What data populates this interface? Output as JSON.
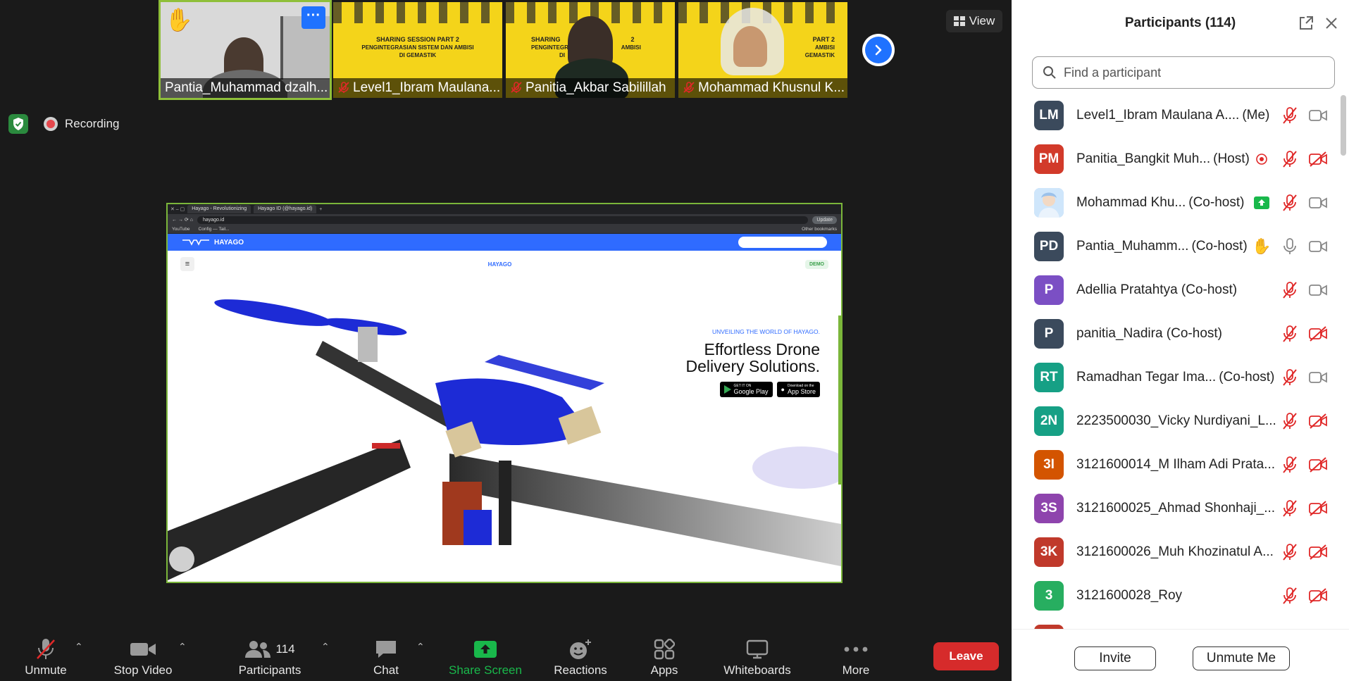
{
  "thumbnails": [
    {
      "name": "Pantia_Muhammad dzalh...",
      "muted": false,
      "raised_hand": true
    },
    {
      "name": "Level1_Ibram Maulana...",
      "muted": true,
      "poster_title": "SHARING SESSION PART 2",
      "poster_sub": "PENGINTEGRASIAN SISTEM DAN AMBISI",
      "poster_sub2": "DI GEMASTIK"
    },
    {
      "name": "Panitia_Akbar Sabilillah",
      "muted": true,
      "poster_title": "SHARING",
      "poster_title_right": "2",
      "poster_sub": "PENGINTEGRASIAN",
      "poster_sub_right": "AMBISI",
      "poster_sub2": "DI"
    },
    {
      "name": "Mohammad Khusnul K...",
      "muted": true,
      "poster_title": "PART 2",
      "poster_sub": "AMBISI",
      "poster_sub2": "GEMASTIK"
    }
  ],
  "view_label": "View",
  "recording_label": "Recording",
  "share": {
    "tab1": "Hayago - Revolutionizing",
    "tab2": "Hayago ID (@hayago.id)",
    "url": "hayago.id",
    "update_label": "Update",
    "bookmark1": "YouTube",
    "bookmark2": "Config — Tail...",
    "bookmark_other": "Other bookmarks",
    "brand": "HAYAGO",
    "nav_logo": "HAYAGO",
    "demo_label": "DEMO",
    "tagline": "UNVEILING THE WORLD OF HAYAGO.",
    "headline_1": "Effortless Drone",
    "headline_2": "Delivery Solutions.",
    "google_small": "GET IT ON",
    "google_big": "Google Play",
    "apple_small": "Download on the",
    "apple_big": "App Store"
  },
  "toolbar": {
    "unmute": "Unmute",
    "stop_video": "Stop Video",
    "participants": "Participants",
    "participants_count": "114",
    "chat": "Chat",
    "share_screen": "Share Screen",
    "reactions": "Reactions",
    "apps": "Apps",
    "whiteboards": "Whiteboards",
    "more": "More",
    "leave": "Leave"
  },
  "panel": {
    "title": "Participants (114)",
    "search_placeholder": "Find a participant",
    "invite": "Invite",
    "unmute_me": "Unmute Me",
    "participants": [
      {
        "initials": "LM",
        "color": "#3b4a5c",
        "name": "Level1_Ibram Maulana A....",
        "role": "(Me)",
        "mic": "muted",
        "video": "on"
      },
      {
        "initials": "PM",
        "color": "#d23a2a",
        "name": "Panitia_Bangkit Muh...",
        "role": "(Host)",
        "mic": "muted",
        "video": "off",
        "extra": "recording"
      },
      {
        "initials": "",
        "color": "#9ec9f0",
        "name": "Mohammad Khu...",
        "role": "(Co-host)",
        "mic": "muted",
        "video": "on",
        "extra": "sharing",
        "photo": true
      },
      {
        "initials": "PD",
        "color": "#3b4a5c",
        "name": "Pantia_Muhamm...",
        "role": "(Co-host)",
        "mic": "on",
        "video": "on",
        "extra": "hand"
      },
      {
        "initials": "P",
        "color": "#7b4fc4",
        "name": "Adellia Pratahtya (Co-host)",
        "role": "",
        "mic": "muted",
        "video": "on"
      },
      {
        "initials": "P",
        "color": "#3b4a5c",
        "name": "panitia_Nadira (Co-host)",
        "role": "",
        "mic": "muted",
        "video": "off"
      },
      {
        "initials": "RT",
        "color": "#16a085",
        "name": "Ramadhan Tegar Ima...",
        "role": "(Co-host)",
        "mic": "muted",
        "video": "on"
      },
      {
        "initials": "2N",
        "color": "#16a085",
        "name": "2223500030_Vicky Nurdiyani_L...",
        "role": "",
        "mic": "muted",
        "video": "off"
      },
      {
        "initials": "3I",
        "color": "#d35400",
        "name": "3121600014_M Ilham Adi Prata...",
        "role": "",
        "mic": "muted",
        "video": "off"
      },
      {
        "initials": "3S",
        "color": "#8e44ad",
        "name": "3121600025_Ahmad Shonhaji_...",
        "role": "",
        "mic": "muted",
        "video": "off"
      },
      {
        "initials": "3K",
        "color": "#c0392b",
        "name": "3121600026_Muh Khozinatul A...",
        "role": "",
        "mic": "muted",
        "video": "off"
      },
      {
        "initials": "3",
        "color": "#27ae60",
        "name": "3121600028_Roy",
        "role": "",
        "mic": "muted",
        "video": "off"
      }
    ]
  },
  "colors": {
    "accent": "#1f72ff",
    "leave": "#d62b2b",
    "share_green": "#19b84b",
    "muted_red": "#e02828"
  }
}
